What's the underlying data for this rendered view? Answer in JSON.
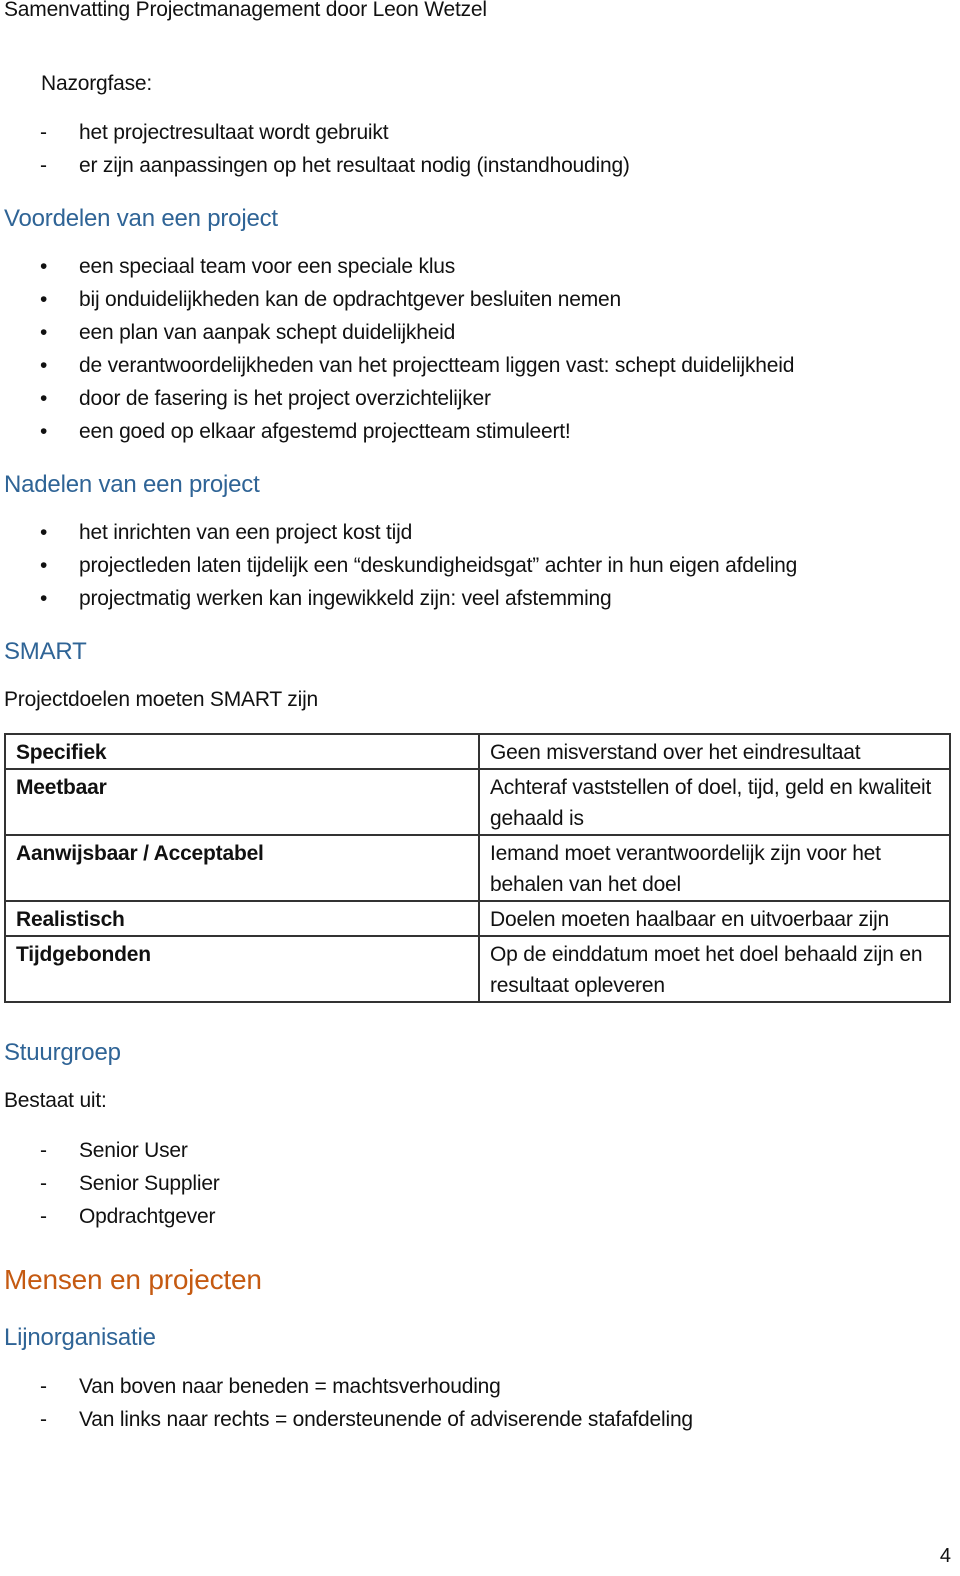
{
  "document": {
    "header": "Samenvatting Projectmanagement door Leon Wetzel",
    "page_number": "4",
    "colors": {
      "heading_blue": "#2f6496",
      "heading_orange": "#c55a11",
      "text": "#111111"
    }
  },
  "nazorgfase": {
    "label": "Nazorgfase:",
    "marker": "-",
    "items": [
      "het projectresultaat wordt gebruikt",
      "er zijn aanpassingen op het resultaat nodig (instandhouding)"
    ]
  },
  "voordelen": {
    "heading": "Voordelen van een project",
    "marker": "•",
    "items": [
      "een speciaal team voor een speciale klus",
      "bij onduidelijkheden kan de opdrachtgever besluiten nemen",
      "een plan van aanpak schept duidelijkheid",
      "de verantwoordelijkheden van het projectteam liggen vast: schept duidelijkheid",
      "door de fasering is het project overzichtelijker",
      "een goed op elkaar afgestemd projectteam stimuleert!"
    ]
  },
  "nadelen": {
    "heading": "Nadelen van een project",
    "marker": "•",
    "items": [
      "het inrichten van een project kost tijd",
      "projectleden laten tijdelijk een “deskundigheidsgat” achter in hun eigen afdeling",
      "projectmatig werken kan ingewikkeld zijn: veel afstemming"
    ]
  },
  "smart": {
    "heading": "SMART",
    "intro": "Projectdoelen moeten SMART zijn",
    "rows": [
      {
        "term": "Specifiek",
        "description": "Geen misverstand over het eindresultaat"
      },
      {
        "term": "Meetbaar",
        "description": "Achteraf vaststellen of doel, tijd, geld en kwaliteit gehaald is"
      },
      {
        "term": "Aanwijsbaar / Acceptabel",
        "description": "Iemand moet verantwoordelijk zijn voor het behalen van het doel"
      },
      {
        "term": "Realistisch",
        "description": "Doelen moeten haalbaar en uitvoerbaar zijn"
      },
      {
        "term": "Tijdgebonden",
        "description": "Op de einddatum moet het doel behaald zijn en resultaat opleveren"
      }
    ]
  },
  "stuurgroep": {
    "heading": "Stuurgroep",
    "intro": "Bestaat uit:",
    "marker": "-",
    "items": [
      "Senior User",
      "Senior Supplier",
      "Opdrachtgever"
    ]
  },
  "mensen": {
    "heading": "Mensen en projecten"
  },
  "lijnorganisatie": {
    "heading": "Lijnorganisatie",
    "marker": "-",
    "items": [
      "Van boven naar beneden = machtsverhouding",
      "Van links naar rechts = ondersteunende of adviserende stafafdeling"
    ]
  }
}
